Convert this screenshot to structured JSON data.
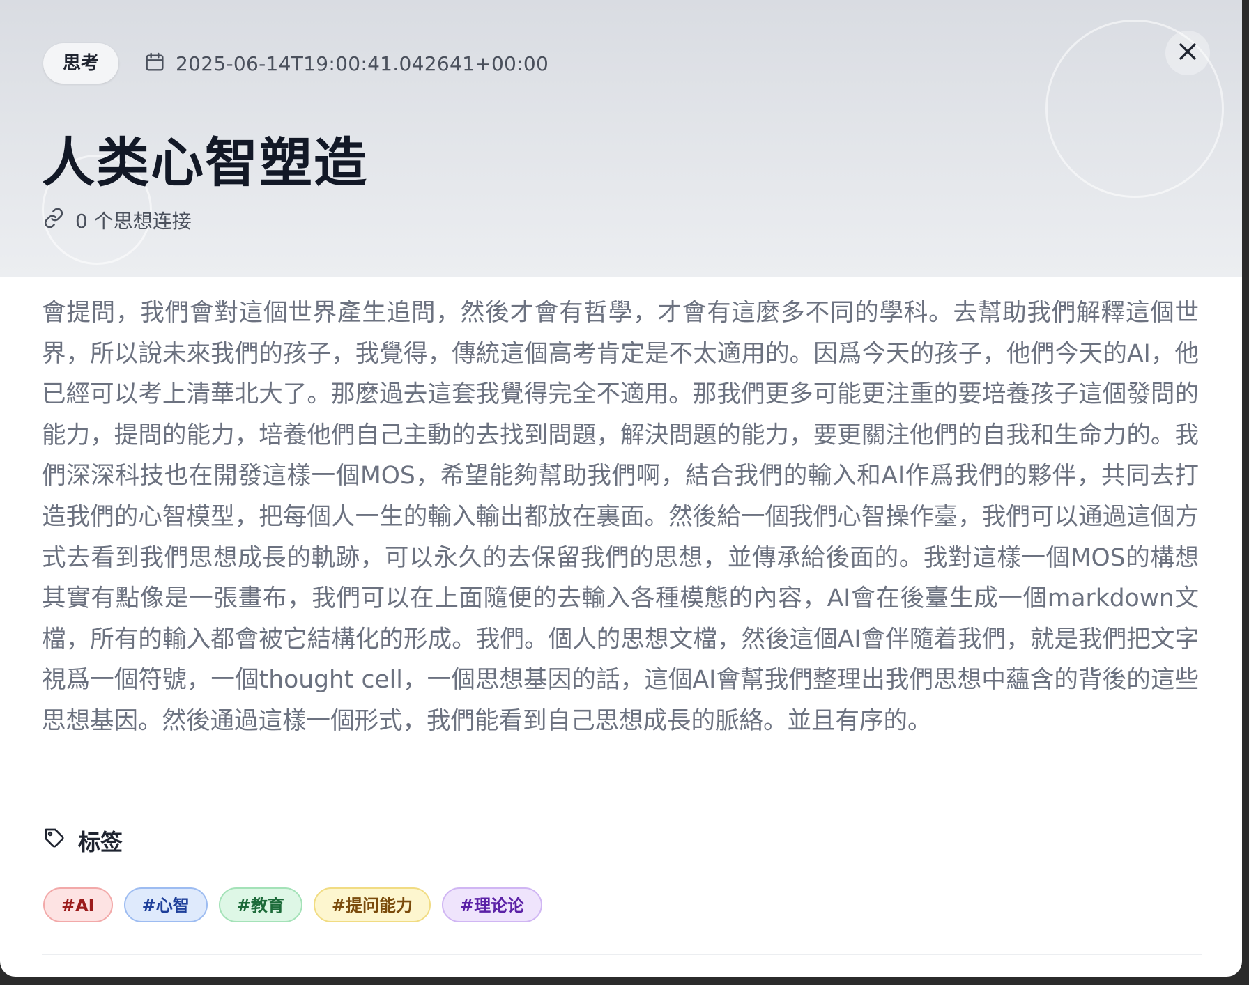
{
  "header": {
    "category": "思考",
    "date": "2025-06-14T19:00:41.042641+00:00",
    "title": "人类心智塑造",
    "connections": "0 个思想连接"
  },
  "content": {
    "body": "會提問，我們會對這個世界產生追問，然後才會有哲學，才會有這麼多不同的學科。去幫助我們解釋這個世界，所以說未來我們的孩子，我覺得，傳統這個高考肯定是不太適用的。因爲今天的孩子，他們今天的AI，他已經可以考上清華北大了。那麼過去這套我覺得完全不適用。那我們更多可能更注重的要培養孩子這個發問的能力，提問的能力，培養他們自己主動的去找到問題，解決問題的能力，要更關注他們的自我和生命力的。我們深深科技也在開發這樣一個MOS，希望能夠幫助我們啊，結合我們的輸入和AI作爲我們的夥伴，共同去打造我們的心智模型，把每個人一生的輸入輸出都放在裏面。然後給一個我們心智操作臺，我們可以通過這個方式去看到我們思想成長的軌跡，可以永久的去保留我們的思想，並傳承給後面的。我對這樣一個MOS的構想其實有點像是一張畫布，我們可以在上面隨便的去輸入各種模態的內容，AI會在後臺生成一個markdown文檔，所有的輸入都會被它結構化的形成。我們。個人的思想文檔，然後這個AI會伴隨着我們，就是我們把文字視爲一個符號，一個thought cell，一個思想基因的話，這個AI會幫我們整理出我們思想中蘊含的背後的這些思想基因。然後通過這樣一個形式，我們能看到自己思想成長的脈絡。並且有序的。"
  },
  "tags": {
    "heading": "标签",
    "items": [
      {
        "label": "#AI",
        "bg": "#fde3e3",
        "border": "#f2a9a9",
        "color": "#9b1c1c"
      },
      {
        "label": "#心智",
        "bg": "#dfeafc",
        "border": "#9dbcf1",
        "color": "#1e3f9a"
      },
      {
        "label": "#教育",
        "bg": "#def7e6",
        "border": "#a4e2b8",
        "color": "#1d6b3a"
      },
      {
        "label": "#提问能力",
        "bg": "#fdf6cf",
        "border": "#f1dc83",
        "color": "#7a4b0c"
      },
      {
        "label": "#理论论",
        "bg": "#efe4fc",
        "border": "#d0b6f3",
        "color": "#5b21a6"
      }
    ]
  },
  "icons": {
    "close": "close-icon",
    "calendar": "calendar-icon",
    "link": "link-icon",
    "tag": "tag-icon"
  }
}
